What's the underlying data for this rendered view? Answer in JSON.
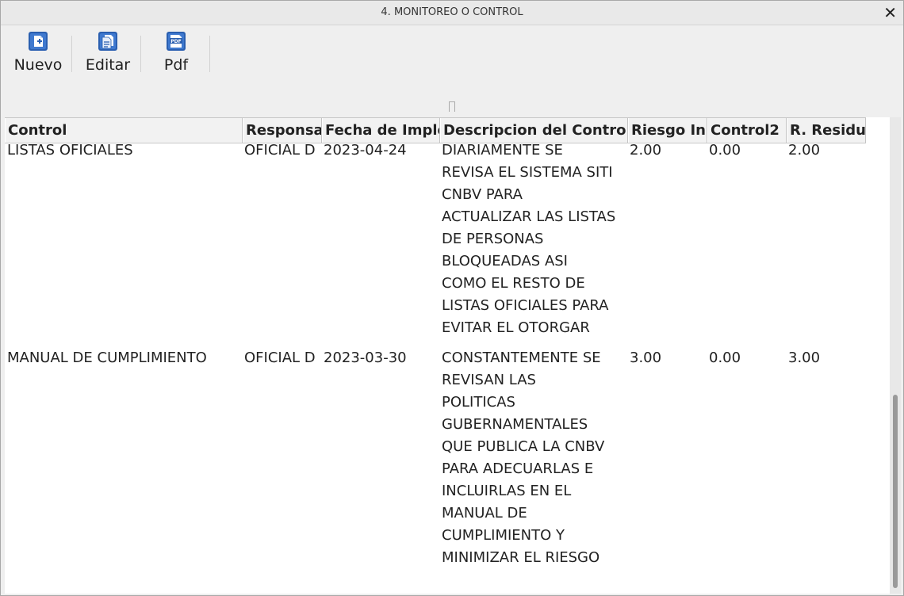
{
  "window": {
    "title": "4. MONITOREO O CONTROL"
  },
  "toolbar": [
    {
      "label": "Nuevo",
      "icon": "new-document-icon"
    },
    {
      "label": "Editar",
      "icon": "edit-document-icon"
    },
    {
      "label": "Pdf",
      "icon": "pdf-icon"
    }
  ],
  "table": {
    "columns": [
      "Control",
      "Responsable",
      "Fecha de Implementacion",
      "Descripcion del Control",
      "Riesgo Inherente",
      "Control2",
      "R. Residual"
    ],
    "rows": [
      {
        "control": "LISTAS OFICIALES",
        "responsable": "OFICIAL D",
        "fecha": "2023-04-24",
        "descripcion": [
          "DIARIAMENTE SE",
          "REVISA EL SISTEMA SITI",
          "CNBV PARA",
          "ACTUALIZAR LAS LISTAS",
          "DE PERSONAS",
          "BLOQUEADAS ASI",
          "COMO EL RESTO DE",
          "LISTAS OFICIALES PARA",
          "EVITAR EL OTORGAR"
        ],
        "riesgo": "2.00",
        "control2": "0.00",
        "residual": "2.00"
      },
      {
        "control": "MANUAL DE CUMPLIMIENTO",
        "responsable": "OFICIAL D",
        "fecha": "2023-03-30",
        "descripcion": [
          "CONSTANTEMENTE SE",
          "REVISAN LAS",
          "POLITICAS",
          "GUBERNAMENTALES",
          "QUE PUBLICA LA CNBV",
          "PARA ADECUARLAS E",
          "INCLUIRLAS EN EL",
          "MANUAL DE",
          "CUMPLIMIENTO Y",
          "MINIMIZAR EL RIESGO"
        ],
        "riesgo": "3.00",
        "control2": "0.00",
        "residual": "3.00"
      }
    ]
  },
  "colors": {
    "header_bg": "#f2f2f2",
    "table_bg": "#ffffff",
    "window_bg": "#efefef",
    "icon_blue": "#2a5fb0"
  }
}
